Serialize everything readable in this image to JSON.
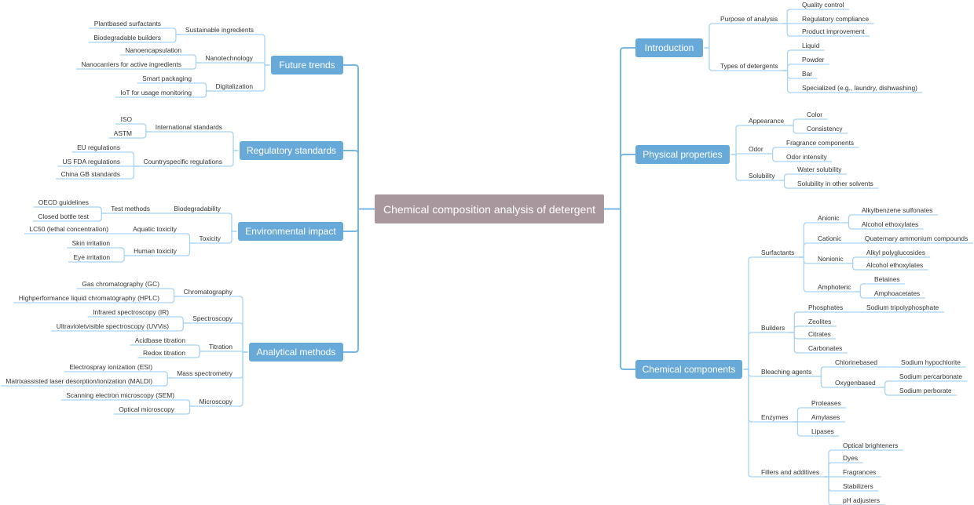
{
  "colors": {
    "root_fill": "#a9979e",
    "main_fill": "#67a9d8",
    "main_link": "#76b7e5",
    "sub_link": "#a9d4f1",
    "text": "#333333"
  },
  "root": {
    "label": "Chemical composition analysis of detergent"
  },
  "left": [
    {
      "label": "Future trends",
      "children": [
        {
          "label": "Sustainable ingredients",
          "children": [
            {
              "label": "Plantbased surfactants"
            },
            {
              "label": "Biodegradable builders"
            }
          ]
        },
        {
          "label": "Nanotechnology",
          "children": [
            {
              "label": "Nanoencapsulation"
            },
            {
              "label": "Nanocarriers for active ingredients"
            }
          ]
        },
        {
          "label": "Digitalization",
          "children": [
            {
              "label": "Smart packaging"
            },
            {
              "label": "IoT for usage monitoring"
            }
          ]
        }
      ]
    },
    {
      "label": "Regulatory standards",
      "children": [
        {
          "label": "International standards",
          "children": [
            {
              "label": "ISO"
            },
            {
              "label": "ASTM"
            }
          ]
        },
        {
          "label": "Countryspecific regulations",
          "children": [
            {
              "label": "EU regulations"
            },
            {
              "label": "US FDA regulations"
            },
            {
              "label": "China GB standards"
            }
          ]
        }
      ]
    },
    {
      "label": "Environmental impact",
      "children": [
        {
          "label": "Biodegradability",
          "children": [
            {
              "label": "Test methods",
              "children": [
                {
                  "label": "OECD guidelines"
                },
                {
                  "label": "Closed bottle test"
                }
              ]
            }
          ]
        },
        {
          "label": "Toxicity",
          "children": [
            {
              "label": "Aquatic toxicity",
              "children": [
                {
                  "label": "LC50 (lethal concentration)"
                }
              ]
            },
            {
              "label": "Human toxicity",
              "children": [
                {
                  "label": "Skin irritation"
                },
                {
                  "label": "Eye irritation"
                }
              ]
            }
          ]
        }
      ]
    },
    {
      "label": "Analytical methods",
      "children": [
        {
          "label": "Chromatography",
          "children": [
            {
              "label": "Gas chromatography (GC)"
            },
            {
              "label": "Highperformance liquid chromatography (HPLC)"
            }
          ]
        },
        {
          "label": "Spectroscopy",
          "children": [
            {
              "label": "Infrared spectroscopy (IR)"
            },
            {
              "label": "Ultravioletvisible spectroscopy (UVVis)"
            }
          ]
        },
        {
          "label": "Titration",
          "children": [
            {
              "label": "Acidbase titration"
            },
            {
              "label": "Redox titration"
            }
          ]
        },
        {
          "label": "Mass spectrometry",
          "children": [
            {
              "label": "Electrospray ionization (ESI)"
            },
            {
              "label": "Matrixassisted laser desorption/ionization (MALDI)"
            }
          ]
        },
        {
          "label": "Microscopy",
          "children": [
            {
              "label": "Scanning electron microscopy (SEM)"
            },
            {
              "label": "Optical microscopy"
            }
          ]
        }
      ]
    }
  ],
  "right": [
    {
      "label": "Introduction",
      "children": [
        {
          "label": "Purpose of analysis",
          "children": [
            {
              "label": "Quality control"
            },
            {
              "label": "Regulatory compliance"
            },
            {
              "label": "Product improvement"
            }
          ]
        },
        {
          "label": "Types of detergents",
          "children": [
            {
              "label": "Liquid"
            },
            {
              "label": "Powder"
            },
            {
              "label": "Bar"
            },
            {
              "label": "Specialized (e.g., laundry, dishwashing)"
            }
          ]
        }
      ]
    },
    {
      "label": "Physical properties",
      "children": [
        {
          "label": "Appearance",
          "children": [
            {
              "label": "Color"
            },
            {
              "label": "Consistency"
            }
          ]
        },
        {
          "label": "Odor",
          "children": [
            {
              "label": "Fragrance components"
            },
            {
              "label": "Odor intensity"
            }
          ]
        },
        {
          "label": "Solubility",
          "children": [
            {
              "label": "Water solubility"
            },
            {
              "label": "Solubility in other solvents"
            }
          ]
        }
      ]
    },
    {
      "label": "Chemical components",
      "children": [
        {
          "label": "Surfactants",
          "children": [
            {
              "label": "Anionic",
              "children": [
                {
                  "label": "Alkylbenzene sulfonates"
                },
                {
                  "label": "Alcohol ethoxylates"
                }
              ]
            },
            {
              "label": "Cationic",
              "children": [
                {
                  "label": "Quaternary ammonium compounds"
                }
              ]
            },
            {
              "label": "Nonionic",
              "children": [
                {
                  "label": "Alkyl polyglucosides"
                },
                {
                  "label": "Alcohol ethoxylates"
                }
              ]
            },
            {
              "label": "Amphoteric",
              "children": [
                {
                  "label": "Betaines"
                },
                {
                  "label": "Amphoacetates"
                }
              ]
            }
          ]
        },
        {
          "label": "Builders",
          "children": [
            {
              "label": "Phosphates",
              "children": [
                {
                  "label": "Sodium tripolyphosphate"
                }
              ]
            },
            {
              "label": "Zeolites"
            },
            {
              "label": "Citrates"
            },
            {
              "label": "Carbonates"
            }
          ]
        },
        {
          "label": "Bleaching agents",
          "children": [
            {
              "label": "Chlorinebased",
              "children": [
                {
                  "label": "Sodium hypochlorite"
                }
              ]
            },
            {
              "label": "Oxygenbased",
              "children": [
                {
                  "label": "Sodium percarbonate"
                },
                {
                  "label": "Sodium perborate"
                }
              ]
            }
          ]
        },
        {
          "label": "Enzymes",
          "children": [
            {
              "label": "Proteases"
            },
            {
              "label": "Amylases"
            },
            {
              "label": "Lipases"
            }
          ]
        },
        {
          "label": "Fillers and additives",
          "children": [
            {
              "label": "Optical brighteners"
            },
            {
              "label": "Dyes"
            },
            {
              "label": "Fragrances"
            },
            {
              "label": "Stabilizers"
            },
            {
              "label": "pH adjusters"
            }
          ]
        }
      ]
    }
  ]
}
